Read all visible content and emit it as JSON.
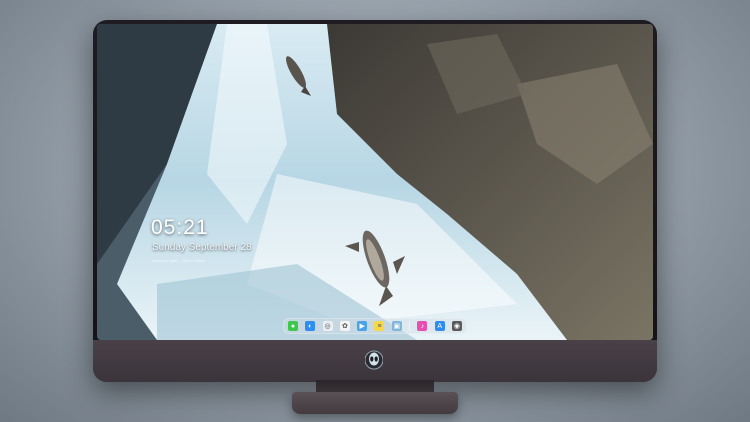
{
  "lockscreen": {
    "time": "05:21",
    "date": "Sunday September 28",
    "note": "Welcome back · Tap to unlock"
  },
  "dock": {
    "items": [
      {
        "name": "messages-icon",
        "color": "#3cc84a",
        "glyph": "●"
      },
      {
        "name": "finder-icon",
        "color": "#2f8cf0",
        "glyph": "◐"
      },
      {
        "name": "safari-icon",
        "color": "#e9eef2",
        "glyph": "◎"
      },
      {
        "name": "photos-icon",
        "color": "#f3f3f3",
        "glyph": "✿"
      },
      {
        "name": "video-icon",
        "color": "#4aa3e6",
        "glyph": "▶"
      },
      {
        "name": "notes-icon",
        "color": "#f6d94a",
        "glyph": "≡"
      },
      {
        "name": "preview-icon",
        "color": "#7fb6d9",
        "glyph": "▣"
      },
      {
        "name": "music-icon",
        "color": "#e54fb0",
        "glyph": "♪"
      },
      {
        "name": "app-store-icon",
        "color": "#2f8cf0",
        "glyph": "A"
      },
      {
        "name": "camera-icon",
        "color": "#5a5a5a",
        "glyph": "◉"
      }
    ]
  }
}
